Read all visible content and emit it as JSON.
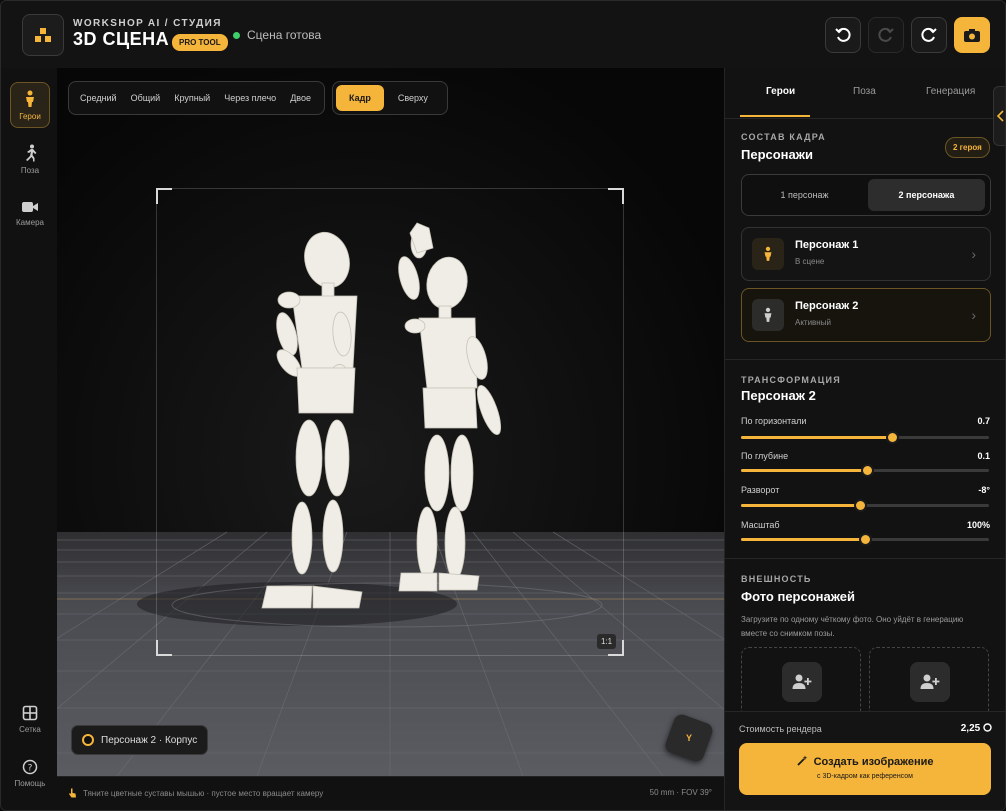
{
  "header": {
    "brand_sub": "WORKSHOP AI / СТУДИЯ",
    "brand_title": "3D СЦЕНА",
    "pro_badge": "PRO TOOL",
    "status": "Сцена готова"
  },
  "leftnav": {
    "items": [
      {
        "label": "Герои",
        "icon": "person-icon",
        "active": true
      },
      {
        "label": "Поза",
        "icon": "running-person-icon",
        "active": false
      },
      {
        "label": "Камера",
        "icon": "video-camera-icon",
        "active": false
      }
    ],
    "bottom": [
      {
        "label": "Сетка",
        "icon": "grid-icon"
      },
      {
        "label": "Помощь",
        "icon": "help-icon"
      }
    ]
  },
  "viewport": {
    "shot_types": [
      "Средний",
      "Общий",
      "Крупный",
      "Через плечо",
      "Двое"
    ],
    "view_modes": [
      {
        "label": "Кадр",
        "active": true
      },
      {
        "label": "Сверху",
        "active": false
      }
    ],
    "ratio": "1:1",
    "target_chip": "Персонаж 2 · Корпус",
    "gizmo_axis": "Y",
    "footer_hint": "Тяните цветные суставы мышью · пустое место вращает камеру",
    "footer_camera": "50 mm · FOV 39°"
  },
  "panel": {
    "tabs": [
      {
        "label": "Герои",
        "active": true
      },
      {
        "label": "Поза",
        "active": false
      },
      {
        "label": "Генерация",
        "active": false
      }
    ],
    "composition": {
      "label": "СОСТАВ КАДРА",
      "title": "Персонажи",
      "badge": "2 героя",
      "options": [
        {
          "label": "1 персонаж",
          "active": false
        },
        {
          "label": "2 персонажа",
          "active": true
        }
      ],
      "characters": [
        {
          "name": "Персонаж 1",
          "status": "В сцене",
          "active": false
        },
        {
          "name": "Персонаж 2",
          "status": "Активный",
          "active": true
        }
      ]
    },
    "transform": {
      "label": "ТРАНСФОРМАЦИЯ",
      "title": "Персонаж 2",
      "sliders": [
        {
          "label": "По горизонтали",
          "value": "0.7",
          "fraction": 0.61
        },
        {
          "label": "По глубине",
          "value": "0.1",
          "fraction": 0.51
        },
        {
          "label": "Разворот",
          "value": "-8°",
          "fraction": 0.48
        },
        {
          "label": "Масштаб",
          "value": "100%",
          "fraction": 0.5
        }
      ]
    },
    "appearance": {
      "label": "ВНЕШНОСТЬ",
      "title": "Фото персонажей",
      "desc": "Загрузите по одному чёткому фото. Оно уйдёт в генерацию вместе со снимком позы."
    },
    "render": {
      "cost_label": "Стоимость рендера",
      "cost_value": "2,25",
      "create_label": "Создать изображение",
      "create_sub": "с 3D-кадром как референсом"
    }
  },
  "colors": {
    "accent": "#f5b43a",
    "status_ok": "#3ecf6b",
    "background": "#0e0e0e"
  }
}
